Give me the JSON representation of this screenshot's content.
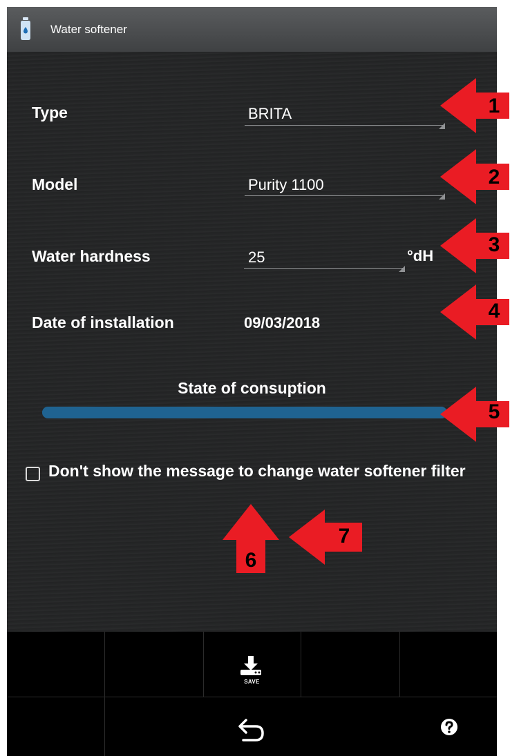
{
  "app": {
    "title": "Water softener"
  },
  "form": {
    "type": {
      "label": "Type",
      "value": "BRITA"
    },
    "model": {
      "label": "Model",
      "value": "Purity 1100"
    },
    "hardness": {
      "label": "Water hardness",
      "value": "25",
      "unit": "°dH"
    },
    "installation": {
      "label": "Date of installation",
      "value": "09/03/2018"
    },
    "consumption": {
      "label": "State of consuption",
      "progress_fraction": 1.0
    },
    "checkbox": {
      "label": "Don't show the message to change water softener filter",
      "checked": false
    }
  },
  "toolbar": {
    "save_label": "SAVE"
  },
  "annotations": [
    "1",
    "2",
    "3",
    "4",
    "5",
    "6",
    "7"
  ],
  "colors": {
    "accent": "#1f6391",
    "annotation_arrow": "#ea1c24"
  },
  "icons": [
    "water-bottle-icon",
    "download-save-icon",
    "back-arrow-icon",
    "help-icon"
  ]
}
